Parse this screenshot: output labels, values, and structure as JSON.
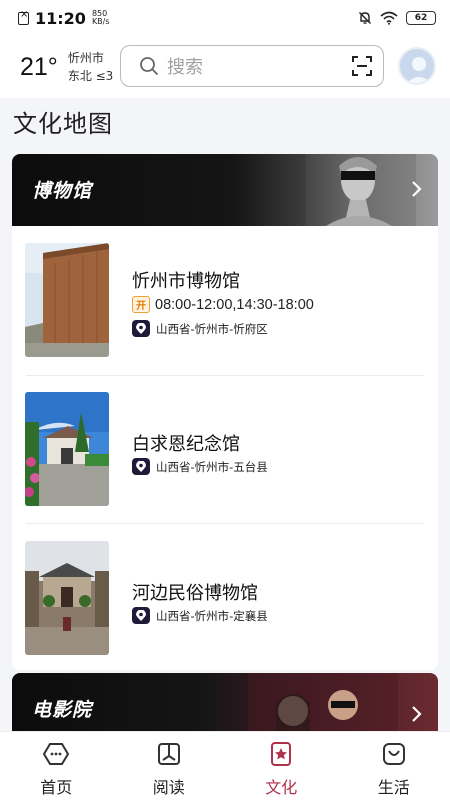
{
  "status_bar": {
    "time": "11:20",
    "net_speed_value": "850",
    "net_speed_unit": "KB/s",
    "battery": "62"
  },
  "header": {
    "temperature": "21°",
    "city": "忻州市",
    "wind": "东北 ≤3",
    "search_placeholder": "搜索"
  },
  "page_title": "文化地图",
  "museum_section": {
    "title": "博物馆",
    "items": [
      {
        "name": "忻州市博物馆",
        "open_badge": "开",
        "hours": "08:00-12:00,14:30-18:00",
        "address": "山西省-忻州市-忻府区"
      },
      {
        "name": "白求恩纪念馆",
        "address": "山西省-忻州市-五台县"
      },
      {
        "name": "河边民俗博物馆",
        "address": "山西省-忻州市-定襄县"
      }
    ]
  },
  "cinema_section": {
    "title": "电影院"
  },
  "bottom_nav": {
    "items": [
      {
        "label": "首页"
      },
      {
        "label": "阅读"
      },
      {
        "label": "文化"
      },
      {
        "label": "生活"
      }
    ],
    "active_color": "#b0324a"
  }
}
